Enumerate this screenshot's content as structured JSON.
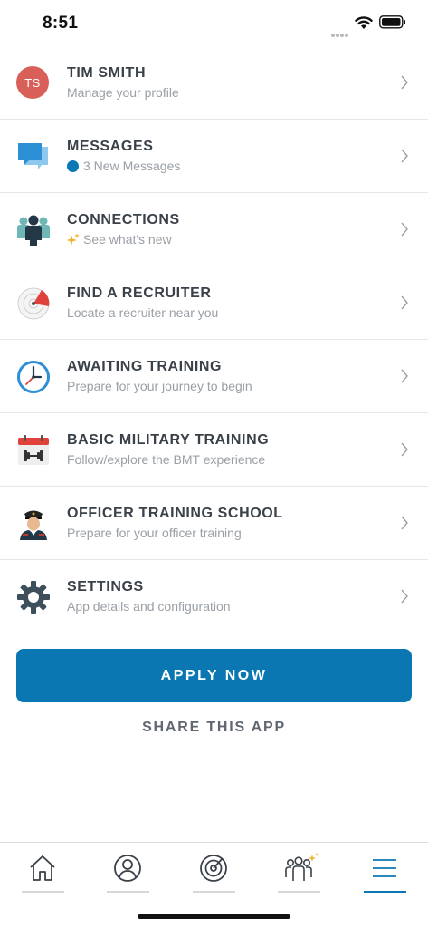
{
  "status_bar": {
    "time": "8:51"
  },
  "menu": {
    "items": [
      {
        "title": "TIM SMITH",
        "subtitle": "Manage your profile",
        "avatar_initials": "TS",
        "icon": "avatar"
      },
      {
        "title": "MESSAGES",
        "subtitle": "3 New Messages",
        "icon": "chat-bubbles-icon"
      },
      {
        "title": "CONNECTIONS",
        "subtitle": "See what's new",
        "icon": "people-group-icon"
      },
      {
        "title": "FIND A RECRUITER",
        "subtitle": "Locate a recruiter near you",
        "icon": "radar-icon"
      },
      {
        "title": "AWAITING TRAINING",
        "subtitle": "Prepare for your journey to begin",
        "icon": "clock-icon"
      },
      {
        "title": "BASIC MILITARY TRAINING",
        "subtitle": "Follow/explore the BMT experience",
        "icon": "calendar-dumbbell-icon"
      },
      {
        "title": "OFFICER TRAINING SCHOOL",
        "subtitle": "Prepare for your officer training",
        "icon": "officer-icon"
      },
      {
        "title": "SETTINGS",
        "subtitle": "App details and configuration",
        "icon": "gear-icon"
      }
    ]
  },
  "actions": {
    "apply_label": "APPLY NOW",
    "share_label": "SHARE THIS APP"
  },
  "tab_bar": {
    "tabs": [
      {
        "icon": "home-icon"
      },
      {
        "icon": "profile-icon"
      },
      {
        "icon": "radar-icon"
      },
      {
        "icon": "connections-icon"
      },
      {
        "icon": "menu-icon",
        "active": true
      }
    ]
  },
  "colors": {
    "accent": "#0a77b3",
    "avatar": "#d96059",
    "text": "#3a4149",
    "subtext": "#9aa0a6"
  }
}
